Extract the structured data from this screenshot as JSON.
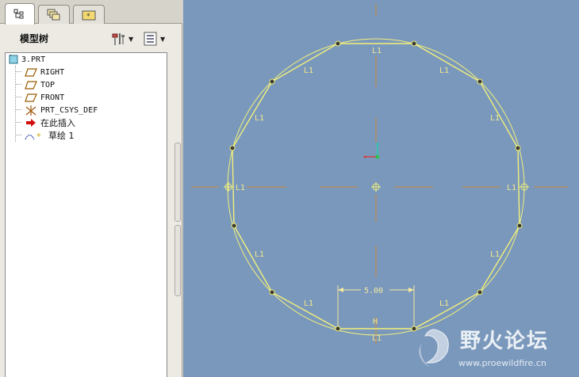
{
  "colors": {
    "graphics_bg": "#7a98bc",
    "sketch_line": "#f2f07a",
    "axis_orange": "#d08a3c",
    "tree_bg": "#ffffff",
    "panel_bg": "#eceae3"
  },
  "tabs": [
    {
      "name": "model-tree",
      "icon": "model-tree-icon",
      "active": true
    },
    {
      "name": "layers",
      "icon": "layers-icon",
      "active": false
    },
    {
      "name": "favorites",
      "icon": "favorites-icon",
      "active": false
    }
  ],
  "tree": {
    "title": "模型树",
    "settings_icon": "settings-icon",
    "show_icon": "show-icon",
    "items": [
      {
        "label": "3.PRT",
        "icon": "part-icon"
      },
      {
        "label": "RIGHT",
        "icon": "datum-plane-icon"
      },
      {
        "label": "TOP",
        "icon": "datum-plane-icon"
      },
      {
        "label": "FRONT",
        "icon": "datum-plane-icon"
      },
      {
        "label": "PRT_CSYS_DEF",
        "icon": "csys-icon"
      },
      {
        "label": "在此插入",
        "icon": "insert-here-arrow-icon"
      },
      {
        "label": "草绘 1",
        "icon": "sketch-icon"
      }
    ]
  },
  "sketch": {
    "polygon_sides": 12,
    "constraint_label": "L1",
    "horizontal_label": "H",
    "dimension": "5.00"
  },
  "watermark": {
    "text": "野火论坛",
    "url": "www.proewildfire.cn"
  }
}
